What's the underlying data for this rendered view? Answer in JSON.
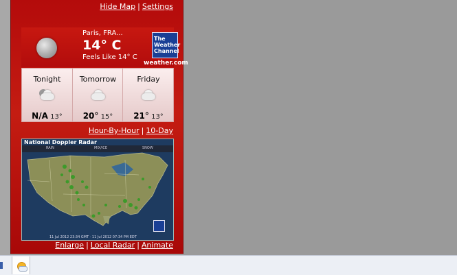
{
  "header": {
    "hide_map": "Hide Map",
    "separator": "|",
    "settings": "Settings"
  },
  "current": {
    "location": "Paris, FRA...",
    "temperature": "14° C",
    "feels_like": "Feels Like 14° C",
    "icon": "moon-icon",
    "logo_text": "The Weather Channel",
    "logo_url": "weather.com"
  },
  "forecast": [
    {
      "name": "Tonight",
      "high": "N/A",
      "low": "13°",
      "icon": "partly-cloudy-night-icon"
    },
    {
      "name": "Tomorrow",
      "high": "20°",
      "low": "15°",
      "icon": "cloudy-icon"
    },
    {
      "name": "Friday",
      "high": "21°",
      "low": "13°",
      "icon": "cloudy-icon"
    }
  ],
  "forecast_links": {
    "hour_by_hour": "Hour-By-Hour",
    "ten_day": "10-Day"
  },
  "radar": {
    "title": "National Doppler Radar",
    "legend": [
      "RAIN",
      "MIX/ICE",
      "SNOW"
    ],
    "legend_scale": [
      "Light",
      "Heavy",
      "Light",
      "Heavy",
      "Light",
      "Heavy"
    ],
    "footer": "11 Jul 2012 23:34 GMT · 11 Jul 2012 07:34 PM EDT"
  },
  "radar_links": {
    "enlarge": "Enlarge",
    "local_radar": "Local Radar",
    "animate": "Animate"
  },
  "colors": {
    "widget_red": "#c41c12",
    "background_gray": "#9a9a9a",
    "taskbar": "#eceff5"
  }
}
